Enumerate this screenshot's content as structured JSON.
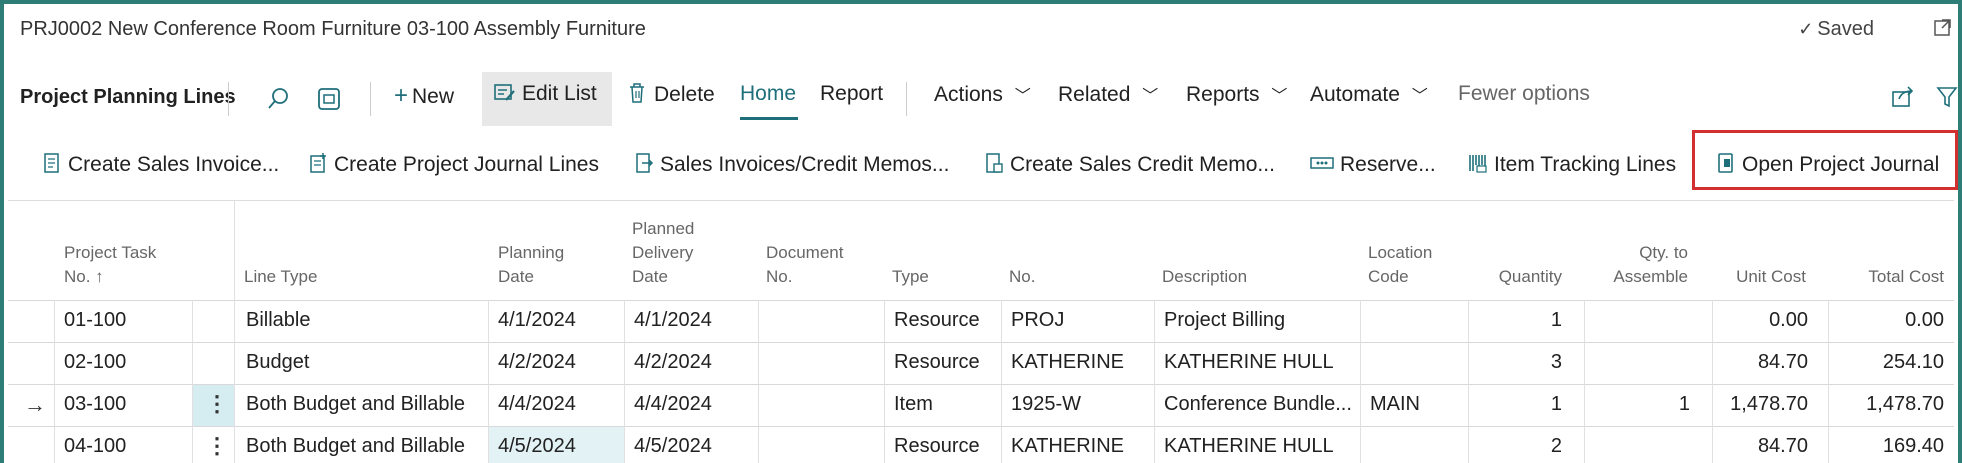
{
  "window": {
    "title": "PRJ0002 New Conference Room Furniture 03-100 Assembly Furniture",
    "saved_label": "Saved"
  },
  "actionbar": {
    "page_title": "Project Planning Lines",
    "new_label": "New",
    "edit_list_label": "Edit List",
    "delete_label": "Delete",
    "home_label": "Home",
    "report_label": "Report",
    "actions_label": "Actions",
    "related_label": "Related",
    "reports_label": "Reports",
    "automate_label": "Automate",
    "fewer_options_label": "Fewer options"
  },
  "promoted": {
    "create_sales_invoice": "Create Sales Invoice...",
    "create_project_journal_lines": "Create Project Journal Lines",
    "sales_invoices_credit_memos": "Sales Invoices/Credit Memos...",
    "create_sales_credit_memo": "Create Sales Credit Memo...",
    "reserve": "Reserve...",
    "item_tracking_lines": "Item Tracking Lines",
    "open_project_journal": "Open Project Journal"
  },
  "columns": {
    "task_no_1": "Project Task",
    "task_no_2": "No. ↑",
    "line_type": "Line Type",
    "planning_date_1": "Planning",
    "planning_date_2": "Date",
    "planned_delivery_1": "Planned",
    "planned_delivery_2": "Delivery",
    "planned_delivery_3": "Date",
    "document_no_1": "Document",
    "document_no_2": "No.",
    "type": "Type",
    "no": "No.",
    "description": "Description",
    "location_code_1": "Location",
    "location_code_2": "Code",
    "quantity": "Quantity",
    "qty_to_assemble_1": "Qty. to",
    "qty_to_assemble_2": "Assemble",
    "unit_cost": "Unit Cost",
    "total_cost": "Total Cost"
  },
  "rows": [
    {
      "task": "01-100",
      "line_type": "Billable",
      "planning_date": "4/1/2024",
      "delivery_date": "4/1/2024",
      "document_no": "",
      "type": "Resource",
      "no": "PROJ",
      "description": "Project Billing",
      "location": "",
      "quantity": "1",
      "qty_assemble": "",
      "unit_cost": "0.00",
      "total_cost": "0.00"
    },
    {
      "task": "02-100",
      "line_type": "Budget",
      "planning_date": "4/2/2024",
      "delivery_date": "4/2/2024",
      "document_no": "",
      "type": "Resource",
      "no": "KATHERINE",
      "description": "KATHERINE HULL",
      "location": "",
      "quantity": "3",
      "qty_assemble": "",
      "unit_cost": "84.70",
      "total_cost": "254.10"
    },
    {
      "task": "03-100",
      "line_type": "Both Budget and Billable",
      "planning_date": "4/4/2024",
      "delivery_date": "4/4/2024",
      "document_no": "",
      "type": "Item",
      "no": "1925-W",
      "description": "Conference Bundle...",
      "location": "MAIN",
      "quantity": "1",
      "qty_assemble": "1",
      "unit_cost": "1,478.70",
      "total_cost": "1,478.70"
    },
    {
      "task": "04-100",
      "line_type": "Both Budget and Billable",
      "planning_date": "4/5/2024",
      "delivery_date": "4/5/2024",
      "document_no": "",
      "type": "Resource",
      "no": "KATHERINE",
      "description": "KATHERINE HULL",
      "location": "",
      "quantity": "2",
      "qty_assemble": "",
      "unit_cost": "84.70",
      "total_cost": "169.40"
    }
  ],
  "current_row_marker": "→",
  "row_menu_glyph": "⋮",
  "colors": {
    "accent": "#1f6f7a",
    "frame": "#2e7d77",
    "highlight": "#d32f2f",
    "selection": "#d5ecf0"
  }
}
